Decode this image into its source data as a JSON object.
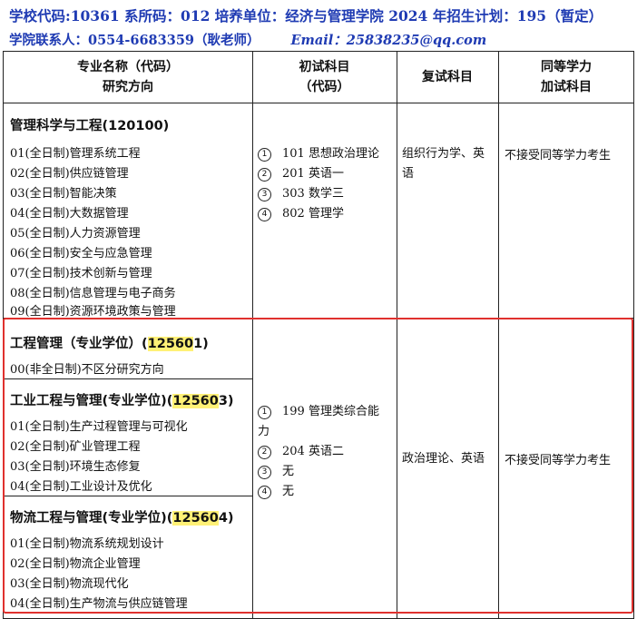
{
  "header": {
    "line1": "学校代码:10361  系所码：012  培养单位：经济与管理学院  2024 年招生计划：195（暂定）",
    "contact": "学院联系人：0554-6683359（耿老师）",
    "email": "Email：25838235@qq.com"
  },
  "table": {
    "col_headers": {
      "major": [
        "专业名称（代码）",
        "研究方向"
      ],
      "initial": [
        "初试科目",
        "（代码）"
      ],
      "retest": "复试科目",
      "equiv": [
        "同等学力",
        "加试科目"
      ]
    },
    "group1": {
      "major": "管理科学与工程(120100)",
      "directions": [
        "01(全日制)管理系统工程",
        "02(全日制)供应链管理",
        "03(全日制)智能决策",
        "04(全日制)大数据管理",
        "05(全日制)人力资源管理",
        "06(全日制)安全与应急管理",
        "07(全日制)技术创新与管理",
        "08(全日制)信息管理与电子商务",
        "09(全日制)资源环境政策与管理"
      ],
      "subjects": [
        {
          "num": "1",
          "text": "101 思想政治理论"
        },
        {
          "num": "2",
          "text": "201 英语一"
        },
        {
          "num": "3",
          "text": "303 数学三"
        },
        {
          "num": "4",
          "text": "802 管理学"
        }
      ],
      "retest_line1": "组织行为学、英",
      "retest_line2": "语",
      "equiv": "不接受同等学力考生"
    },
    "group2": {
      "majors": [
        {
          "prefix": "工程管理（专业学位）(",
          "hl": "12560",
          "suffix": "1)",
          "directions": [
            "00(非全日制)不区分研究方向"
          ]
        },
        {
          "prefix": "工业工程与管理(专业学位)(",
          "hl": "12560",
          "suffix": "3)",
          "directions": [
            "01(全日制)生产过程管理与可视化",
            "02(全日制)矿业管理工程",
            "03(全日制)环境生态修复",
            "04(全日制)工业设计及优化"
          ]
        },
        {
          "prefix": "物流工程与管理(专业学位)(",
          "hl": "12560",
          "suffix": "4)",
          "directions": [
            "01(全日制)物流系统规划设计",
            "02(全日制)物流企业管理",
            "03(全日制)物流现代化",
            "04(全日制)生产物流与供应链管理"
          ]
        }
      ],
      "subjects": [
        {
          "num": "1",
          "text": "199 管理类综合能"
        },
        {
          "num": "",
          "text": "力"
        },
        {
          "num": "2",
          "text": "204 英语二"
        },
        {
          "num": "3",
          "text": "无"
        },
        {
          "num": "4",
          "text": "无"
        }
      ],
      "retest": "政治理论、英语",
      "equiv": "不接受同等学力考生"
    }
  },
  "colors": {
    "header_text": "#1f3bb3",
    "highlight": "#fff176",
    "box": "#e0312e"
  }
}
